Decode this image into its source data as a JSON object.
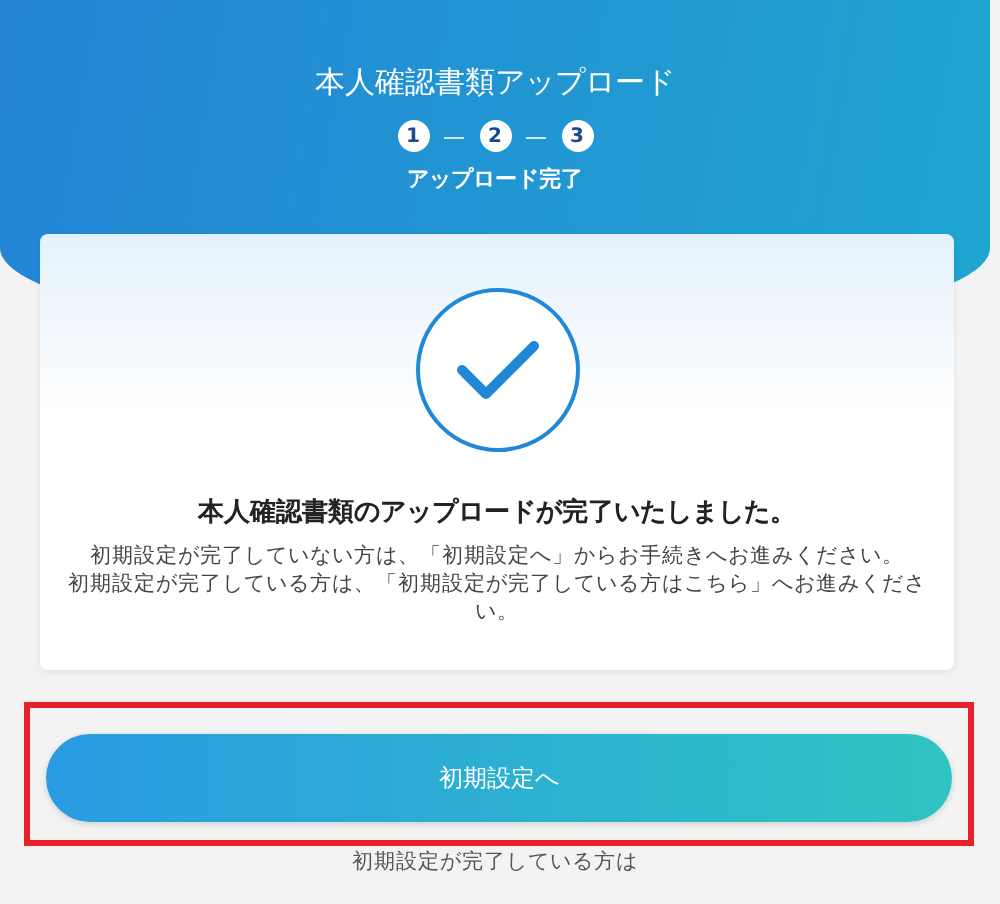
{
  "header": {
    "title": "本人確認書類アップロード",
    "steps": [
      {
        "label": "1"
      },
      {
        "label": "2"
      },
      {
        "label": "3"
      }
    ],
    "separator": "—",
    "step_label": "アップロード完了"
  },
  "card": {
    "heading": "本人確認書類のアップロードが完了いたしました。",
    "notes": [
      "初期設定が完了していない方は、「初期設定へ」からお手続きへお進みください。",
      "初期設定が完了している方は、「初期設定が完了している方はこちら」へお進みください。"
    ]
  },
  "button": {
    "label": "初期設定へ",
    "highlighted": true
  },
  "footer_text": "初期設定が完了している方は"
}
